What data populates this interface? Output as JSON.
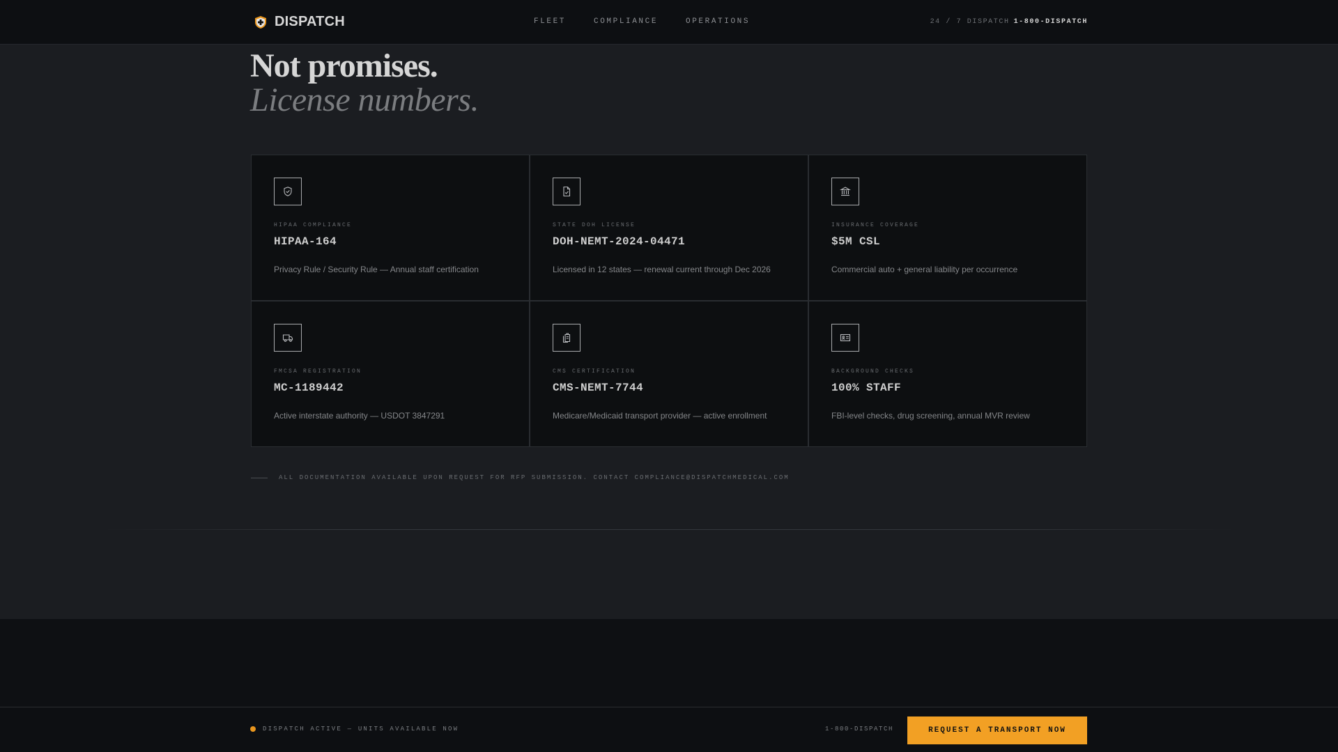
{
  "nav": {
    "brand": "DISPATCH",
    "links": [
      "FLEET",
      "COMPLIANCE",
      "OPERATIONS"
    ],
    "phone_prefix": "24 / 7 DISPATCH",
    "phone": "1-800-DISPATCH"
  },
  "headline": {
    "line1": "Not promises.",
    "line2": "License numbers."
  },
  "cards": [
    {
      "icon": "shield-check-icon",
      "label": "HIPAA COMPLIANCE",
      "value": "HIPAA-164",
      "desc": "Privacy Rule / Security Rule — Annual staff certification"
    },
    {
      "icon": "document-check-icon",
      "label": "STATE DOH LICENSE",
      "value": "DOH-NEMT-2024-04471",
      "desc": "Licensed in 12 states — renewal current through Dec 2026"
    },
    {
      "icon": "bank-building-icon",
      "label": "INSURANCE COVERAGE",
      "value": "$5M CSL",
      "desc": "Commercial auto + general liability per occurrence"
    },
    {
      "icon": "truck-icon",
      "label": "FMCSA REGISTRATION",
      "value": "MC-1189442",
      "desc": "Active interstate authority — USDOT 3847291"
    },
    {
      "icon": "clipboard-copy-icon",
      "label": "CMS CERTIFICATION",
      "value": "CMS-NEMT-7744",
      "desc": "Medicare/Medicaid transport provider — active enrollment"
    },
    {
      "icon": "id-card-icon",
      "label": "BACKGROUND CHECKS",
      "value": "100% STAFF",
      "desc": "FBI-level checks, drug screening, annual MVR review"
    }
  ],
  "note": "ALL DOCUMENTATION AVAILABLE UPON REQUEST FOR RFP SUBMISSION. CONTACT COMPLIANCE@DISPATCHMEDICAL.COM",
  "bottom_bar": {
    "status": "DISPATCH ACTIVE — UNITS AVAILABLE NOW",
    "phone": "1-800-DISPATCH",
    "cta": "REQUEST A TRANSPORT NOW"
  },
  "colors": {
    "accent": "#f2a024",
    "background": "#1b1d21",
    "card": "#0d0f11"
  }
}
